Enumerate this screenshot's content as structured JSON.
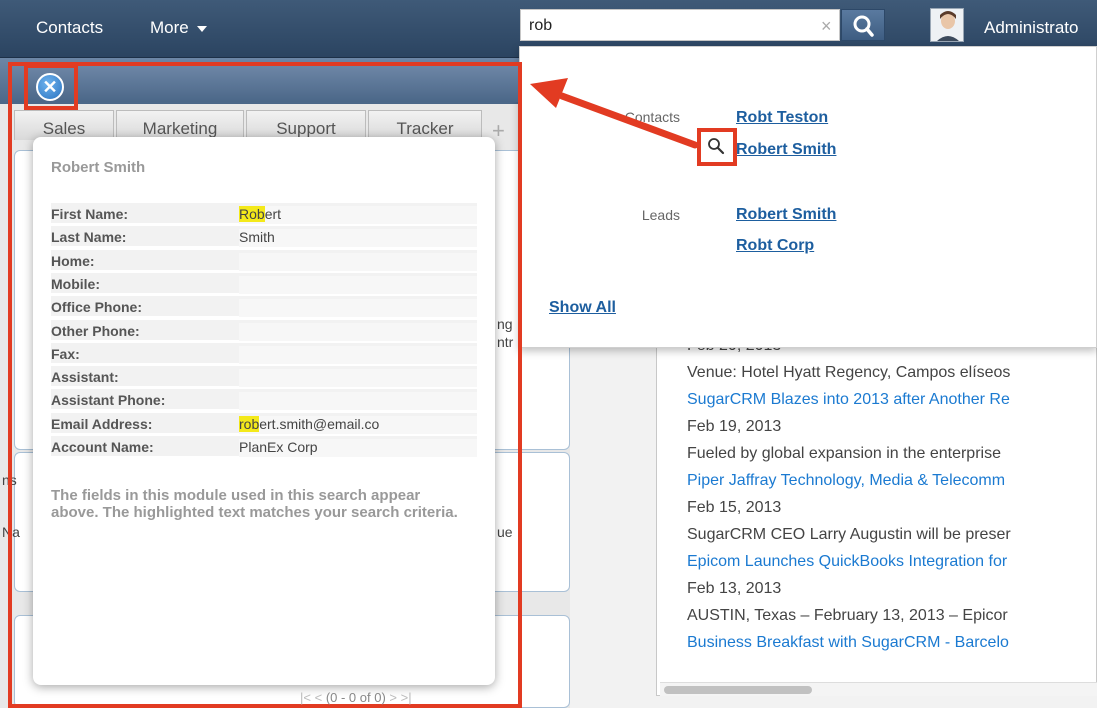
{
  "nav": {
    "contacts": "Contacts",
    "more": "More",
    "user": "Administrato"
  },
  "search": {
    "query": "rob",
    "clear": "×"
  },
  "dashboard_tabs": [
    "Sales",
    "Marketing",
    "Support",
    "Tracker"
  ],
  "dashboard_fragments": {
    "frag1": "ng",
    "frag2": "ntr",
    "frag3": "ns",
    "frag4": "Na",
    "frag5": "ue"
  },
  "pager": "(0 - 0 of 0)",
  "dropdown": {
    "contacts_label": "Contacts",
    "contact_results": [
      "Robt Teston",
      "Robert Smith"
    ],
    "leads_label": "Leads",
    "lead_results": [
      "Robert Smith",
      "Robt Corp"
    ],
    "show_all": "Show All"
  },
  "preview": {
    "title": "Robert Smith",
    "fields": [
      {
        "label": "First Name:",
        "hl": "Rob",
        "rest": "ert"
      },
      {
        "label": "Last Name:",
        "hl": "",
        "rest": "Smith"
      },
      {
        "label": "Home:",
        "hl": "",
        "rest": ""
      },
      {
        "label": "Mobile:",
        "hl": "",
        "rest": ""
      },
      {
        "label": "Office Phone:",
        "hl": "",
        "rest": ""
      },
      {
        "label": "Other Phone:",
        "hl": "",
        "rest": ""
      },
      {
        "label": "Fax:",
        "hl": "",
        "rest": ""
      },
      {
        "label": "Assistant:",
        "hl": "",
        "rest": ""
      },
      {
        "label": "Assistant Phone:",
        "hl": "",
        "rest": ""
      },
      {
        "label": "Email Address:",
        "hl": "rob",
        "rest": "ert.smith@email.co"
      },
      {
        "label": "Account Name:",
        "hl": "",
        "rest": "PlanEx Corp"
      }
    ],
    "note": "The fields in this module used in this search appear above. The highlighted text matches your search criteria."
  },
  "news": [
    {
      "text": "Feb 20, 2013",
      "link": false
    },
    {
      "text": "Venue: Hotel Hyatt Regency, Campos elíseos",
      "link": false
    },
    {
      "text": "SugarCRM Blazes into 2013 after Another Re",
      "link": true
    },
    {
      "text": "Feb 19, 2013",
      "link": false
    },
    {
      "text": "Fueled by global expansion in the enterprise",
      "link": false
    },
    {
      "text": "Piper Jaffray Technology, Media & Telecomm",
      "link": true
    },
    {
      "text": "Feb 15, 2013",
      "link": false
    },
    {
      "text": "SugarCRM CEO Larry Augustin will be preser",
      "link": false
    },
    {
      "text": "Epicom Launches QuickBooks Integration for",
      "link": true
    },
    {
      "text": "Feb 13, 2013",
      "link": false
    },
    {
      "text": "AUSTIN, Texas – February 13, 2013 – Epicor",
      "link": false
    },
    {
      "text": "Business Breakfast with SugarCRM - Barcelo",
      "link": true
    }
  ],
  "colors": {
    "nav_bg": "#2b4461",
    "annotation_red": "#e23b22",
    "link_blue": "#1d5e9f",
    "highlight": "#f4e91a"
  },
  "icons": {
    "search": "search-icon",
    "close": "close-icon",
    "preview": "magnifier-icon",
    "add_tab": "plus-icon"
  }
}
